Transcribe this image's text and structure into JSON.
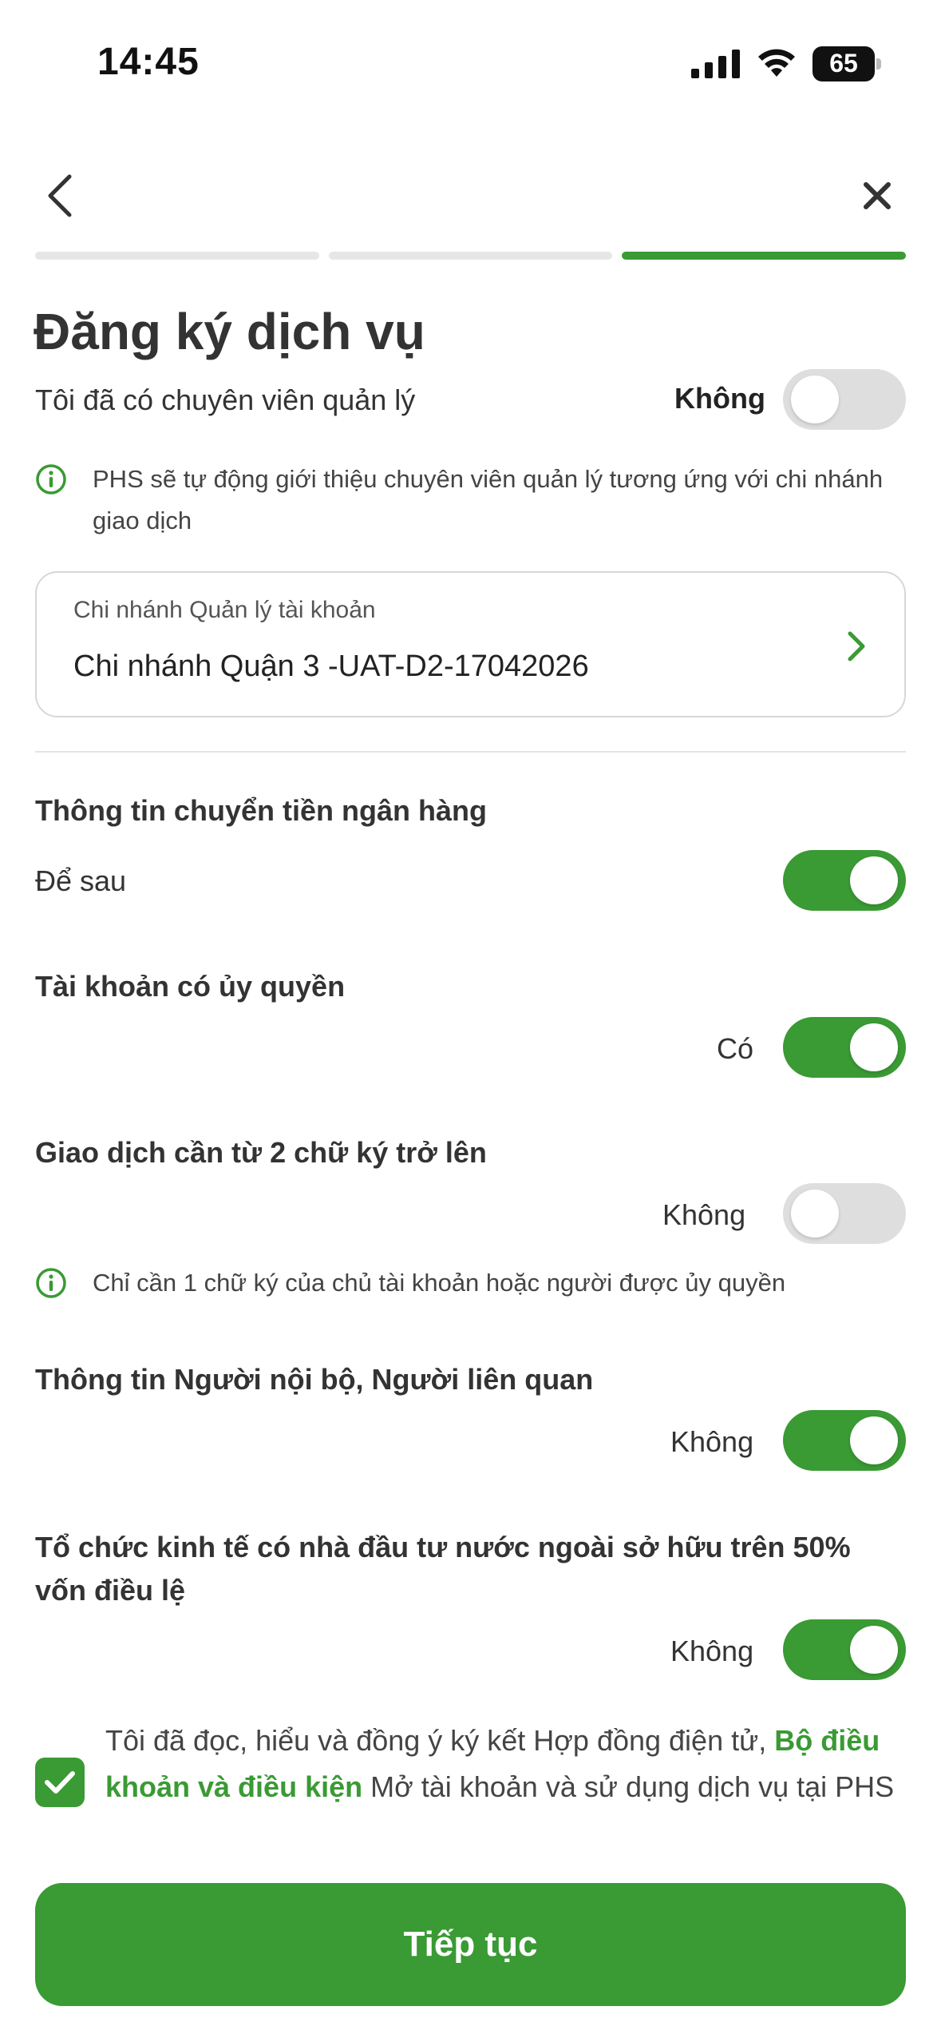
{
  "status_bar": {
    "time": "14:45",
    "battery": "65"
  },
  "colors": {
    "accent": "#3a9a34",
    "toggle_off": "#dedede"
  },
  "page": {
    "title": "Đăng ký dịch vụ"
  },
  "manager": {
    "label": "Tôi đã có chuyên viên quản lý",
    "value": "Không",
    "toggle_on": false
  },
  "manager_info": "PHS sẽ tự động giới thiệu chuyên viên quản lý tương ứng với chi nhánh giao dịch",
  "branch": {
    "label": "Chi nhánh Quản lý tài khoản",
    "value": "Chi nhánh Quận 3 -UAT-D2-17042026"
  },
  "bank": {
    "title": "Thông tin chuyển tiền ngân hàng",
    "value": "Để sau",
    "toggle_on": true
  },
  "authorized": {
    "title": "Tài khoản có ủy quyền",
    "value": "Có",
    "toggle_on": true
  },
  "multi_sign": {
    "title": "Giao dịch cần từ 2 chữ ký trở lên",
    "value": "Không",
    "toggle_on": false,
    "info": "Chỉ cần 1 chữ ký của chủ tài khoản hoặc người được ủy quyền"
  },
  "insider": {
    "title": "Thông tin Người nội bộ, Người liên quan",
    "value": "Không",
    "toggle_on": true
  },
  "foreign": {
    "title": "Tổ chức kinh tế có nhà đầu tư nước ngoài sở hữu trên 50% vốn điều lệ",
    "value": "Không",
    "toggle_on": true
  },
  "agreement": {
    "prefix": "Tôi đã đọc, hiểu và đồng ý ký kết Hợp đồng điện tử,",
    "link": "Bộ điều khoản và điều kiện",
    "suffix": "Mở tài khoản và sử dụng dịch vụ tại PHS",
    "checked": true
  },
  "actions": {
    "continue_label": "Tiếp tục"
  }
}
